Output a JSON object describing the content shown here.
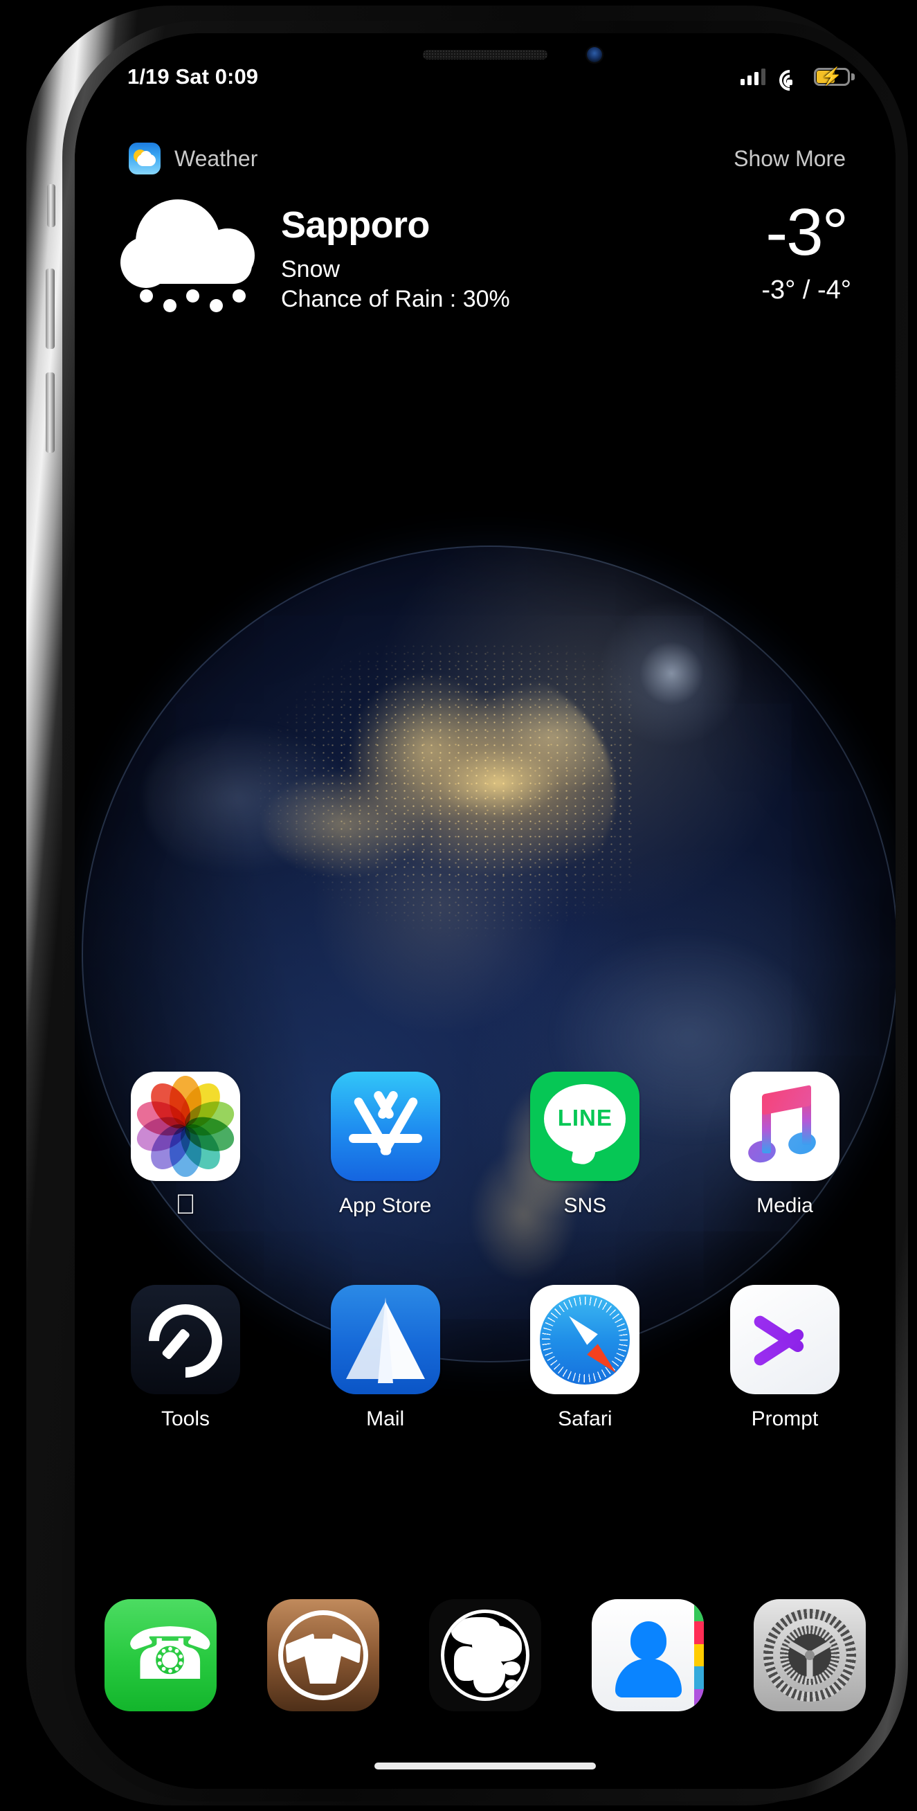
{
  "status_bar": {
    "time": "1/19 Sat 0:09",
    "signal_icon": "cellular-signal-icon",
    "signal_bars_total": 4,
    "signal_bars_active": 3,
    "wifi_icon": "wifi-icon",
    "battery_icon": "battery-charging-icon",
    "battery_color": "#f4c026",
    "battery_charging": true
  },
  "weather_widget": {
    "app_name": "Weather",
    "show_more_label": "Show More",
    "app_icon": "weather-app-icon",
    "condition_icon": "snow-cloud-icon",
    "city": "Sapporo",
    "condition": "Snow",
    "rain_chance": "Chance of Rain : 30%",
    "temp_current": "-3°",
    "temp_range": "-3° / -4°"
  },
  "home_screen": {
    "row1": [
      {
        "label": "",
        "icon": "photos-icon",
        "is_apple_glyph": true
      },
      {
        "label": "App Store",
        "icon": "app-store-icon"
      },
      {
        "label": "SNS",
        "icon": "line-icon",
        "icon_text": "LINE"
      },
      {
        "label": "Media",
        "icon": "apple-music-icon"
      }
    ],
    "row2": [
      {
        "label": "Tools",
        "icon": "speedtest-gauge-icon"
      },
      {
        "label": "Mail",
        "icon": "spark-mail-paper-plane-icon"
      },
      {
        "label": "Safari",
        "icon": "safari-compass-icon"
      },
      {
        "label": "Prompt",
        "icon": "prompt-chevron-icon"
      }
    ]
  },
  "dock": [
    {
      "icon": "phone-icon",
      "name": "Phone"
    },
    {
      "icon": "cydia-box-icon",
      "name": "Cydia"
    },
    {
      "icon": "globe-browser-icon",
      "name": "Globe"
    },
    {
      "icon": "contacts-person-icon",
      "name": "Contacts"
    },
    {
      "icon": "settings-gears-icon",
      "name": "Settings"
    }
  ],
  "device": {
    "frame_color": "#d8d8d8",
    "wallpaper": "earth-at-night",
    "home_indicator": "home-indicator"
  }
}
